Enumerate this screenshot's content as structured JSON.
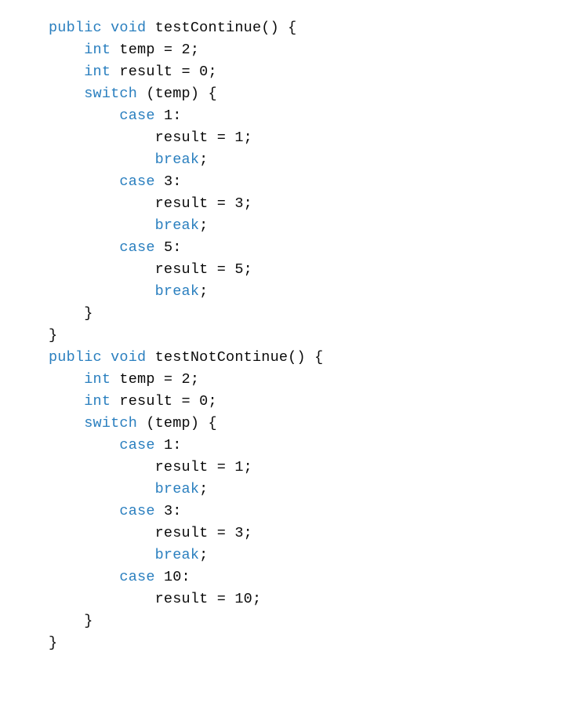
{
  "tokens": [
    {
      "cls": "kw",
      "t": "public"
    },
    {
      "t": " "
    },
    {
      "cls": "kw",
      "t": "void"
    },
    {
      "t": " testContinue() {\n"
    },
    {
      "t": "    "
    },
    {
      "cls": "kw",
      "t": "int"
    },
    {
      "t": " temp = 2;\n"
    },
    {
      "t": "    "
    },
    {
      "cls": "kw",
      "t": "int"
    },
    {
      "t": " result = 0;\n"
    },
    {
      "t": "    "
    },
    {
      "cls": "kw",
      "t": "switch"
    },
    {
      "t": " (temp) {\n"
    },
    {
      "t": "        "
    },
    {
      "cls": "kw",
      "t": "case"
    },
    {
      "t": " 1:\n"
    },
    {
      "t": "            result = 1;\n"
    },
    {
      "t": "            "
    },
    {
      "cls": "kw",
      "t": "break"
    },
    {
      "t": ";\n"
    },
    {
      "t": "        "
    },
    {
      "cls": "kw",
      "t": "case"
    },
    {
      "t": " 3:\n"
    },
    {
      "t": "            result = 3;\n"
    },
    {
      "t": "            "
    },
    {
      "cls": "kw",
      "t": "break"
    },
    {
      "t": ";\n"
    },
    {
      "t": "        "
    },
    {
      "cls": "kw",
      "t": "case"
    },
    {
      "t": " 5:\n"
    },
    {
      "t": "            result = 5;\n"
    },
    {
      "t": "            "
    },
    {
      "cls": "kw",
      "t": "break"
    },
    {
      "t": ";\n"
    },
    {
      "t": "    }\n"
    },
    {
      "t": "}\n"
    },
    {
      "cls": "kw",
      "t": "public"
    },
    {
      "t": " "
    },
    {
      "cls": "kw",
      "t": "void"
    },
    {
      "t": " testNotContinue() {\n"
    },
    {
      "t": "    "
    },
    {
      "cls": "kw",
      "t": "int"
    },
    {
      "t": " temp = 2;\n"
    },
    {
      "t": "    "
    },
    {
      "cls": "kw",
      "t": "int"
    },
    {
      "t": " result = 0;\n"
    },
    {
      "t": "    "
    },
    {
      "cls": "kw",
      "t": "switch"
    },
    {
      "t": " (temp) {\n"
    },
    {
      "t": "        "
    },
    {
      "cls": "kw",
      "t": "case"
    },
    {
      "t": " 1:\n"
    },
    {
      "t": "            result = 1;\n"
    },
    {
      "t": "            "
    },
    {
      "cls": "kw",
      "t": "break"
    },
    {
      "t": ";\n"
    },
    {
      "t": "        "
    },
    {
      "cls": "kw",
      "t": "case"
    },
    {
      "t": " 3:\n"
    },
    {
      "t": "            result = 3;\n"
    },
    {
      "t": "            "
    },
    {
      "cls": "kw",
      "t": "break"
    },
    {
      "t": ";\n"
    },
    {
      "t": "        "
    },
    {
      "cls": "kw",
      "t": "case"
    },
    {
      "t": " 10:\n"
    },
    {
      "t": "            result = 10;\n"
    },
    {
      "t": "    }\n"
    },
    {
      "t": "}"
    }
  ]
}
